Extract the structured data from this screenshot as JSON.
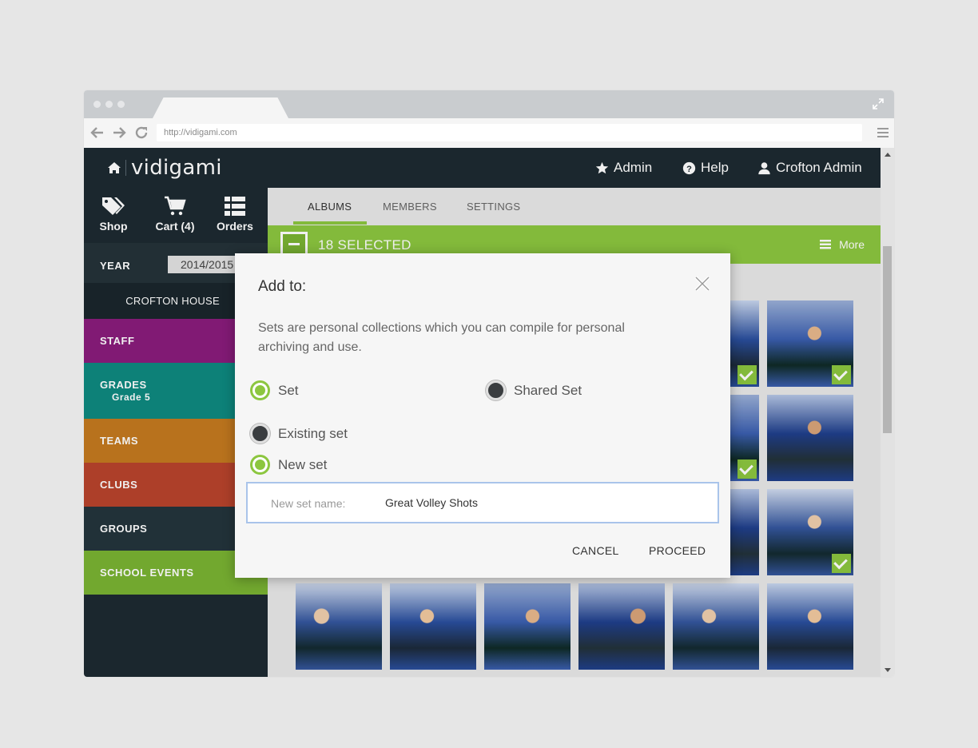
{
  "browser": {
    "url": "http://vidigami.com"
  },
  "header": {
    "logo": "vidigami",
    "admin_label": "Admin",
    "help_label": "Help",
    "user_label": "Crofton Admin"
  },
  "sidebar": {
    "actions": [
      {
        "label": "Shop",
        "icon": "tag-icon"
      },
      {
        "label": "Cart (4)",
        "icon": "cart-icon"
      },
      {
        "label": "Orders",
        "icon": "list-icon"
      }
    ],
    "year_label": "YEAR",
    "year_value": "2014/2015",
    "school": "CROFTON HOUSE",
    "categories": [
      {
        "label": "STAFF",
        "color": "#8a1c7c"
      },
      {
        "label": "GRADES",
        "sub": "Grade 5",
        "color": "#0e8a80"
      },
      {
        "label": "TEAMS",
        "color": "#c47a1f"
      },
      {
        "label": "CLUBS",
        "color": "#b8432c"
      },
      {
        "label": "GROUPS",
        "color": "#24353c"
      },
      {
        "label": "SCHOOL EVENTS",
        "color": "#7ab332"
      }
    ]
  },
  "tabs": [
    {
      "label": "ALBUMS",
      "active": true
    },
    {
      "label": "MEMBERS",
      "active": false
    },
    {
      "label": "SETTINGS",
      "active": false
    }
  ],
  "selection": {
    "count_label": "18 SELECTED",
    "more_label": "More"
  },
  "modal": {
    "title": "Add to:",
    "description": "Sets are personal collections which you can compile for personal archiving and use.",
    "type_options": [
      {
        "label": "Set",
        "selected": true
      },
      {
        "label": "Shared Set",
        "selected": false
      }
    ],
    "mode_options": [
      {
        "label": "Existing set",
        "selected": false
      },
      {
        "label": "New set",
        "selected": true
      }
    ],
    "name_label": "New set name:",
    "name_value": "Great Volley Shots",
    "cancel_label": "CANCEL",
    "proceed_label": "PROCEED"
  },
  "colors": {
    "accent": "#8cc63f",
    "dark": "#1d2a31"
  }
}
